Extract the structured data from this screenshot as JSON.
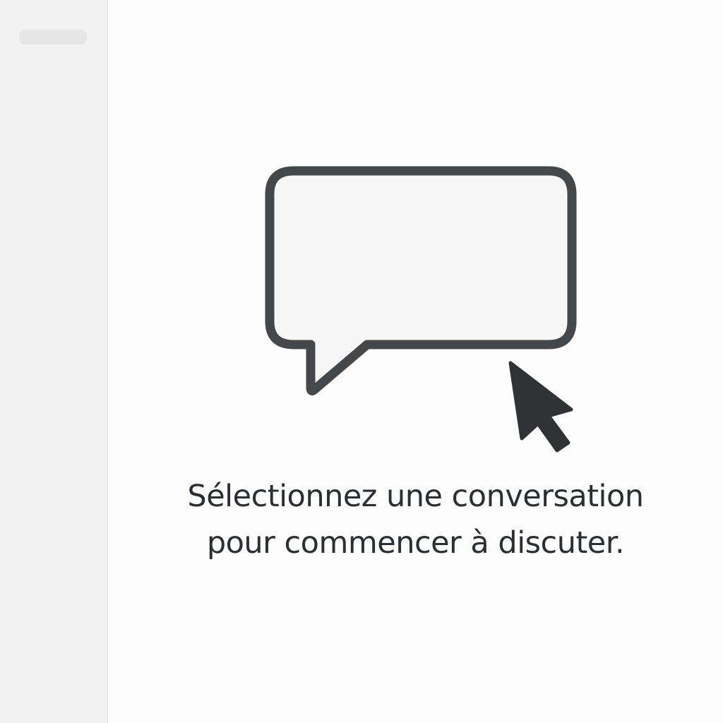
{
  "empty_state": {
    "message_line1": "Sélectionnez une conversation",
    "message_line2": "pour commencer à discuter.",
    "icon": "chat-bubble-icon",
    "cursor_icon": "mouse-pointer-icon"
  },
  "colors": {
    "sidebar_background": "#f2f2f2",
    "main_background": "#fdfdfd",
    "icon_stroke": "#45484b",
    "text": "#2b2f33"
  }
}
